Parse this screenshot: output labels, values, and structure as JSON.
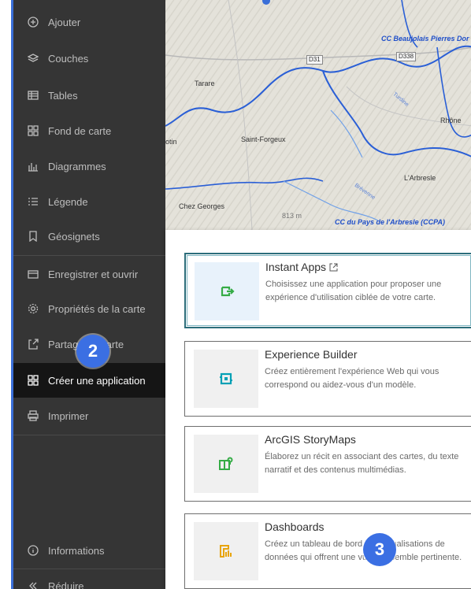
{
  "sidebar": {
    "items": [
      {
        "label": "Ajouter",
        "icon": "plus-circle-icon"
      },
      {
        "label": "Couches",
        "icon": "layers-icon"
      },
      {
        "label": "Tables",
        "icon": "table-icon"
      },
      {
        "label": "Fond de carte",
        "icon": "basemap-icon"
      },
      {
        "label": "Diagrammes",
        "icon": "chart-icon"
      },
      {
        "label": "Légende",
        "icon": "legend-icon"
      },
      {
        "label": "Géosignets",
        "icon": "bookmark-icon"
      },
      {
        "label": "Enregistrer et ouvrir",
        "icon": "folder-icon"
      },
      {
        "label": "Propriétés de la carte",
        "icon": "gear-icon"
      },
      {
        "label": "Partager la carte",
        "icon": "share-icon"
      },
      {
        "label": "Créer une application",
        "icon": "apps-grid-icon"
      },
      {
        "label": "Imprimer",
        "icon": "print-icon"
      },
      {
        "label": "Informations",
        "icon": "info-icon"
      },
      {
        "label": "Réduire",
        "icon": "collapse-icon"
      }
    ],
    "active": "Créer une application"
  },
  "map": {
    "labels": {
      "cc_beaujolais": "CC Beaujolais Pierres Dor",
      "d31": "D31",
      "d338": "D338",
      "tarare": "Tarare",
      "rhone": "Rhône",
      "saint_forgeux": "Saint-Forgeux",
      "otin": "otin",
      "arbresle": "L'Arbresle",
      "chez_georges": "Chez Georges",
      "alt": "813 m",
      "cc_arbresle": "CC du Pays de l'Arbresle (CCPA)",
      "turdine": "Turdine",
      "brevenne": "Brévenne"
    }
  },
  "panel": {
    "cards": [
      {
        "title": "Instant Apps",
        "desc": "Choisissez une application pour proposer une expérience d'utilisation ciblée de votre carte.",
        "icon": "instant-apps-icon",
        "icon_color": "#35ac46",
        "external": true
      },
      {
        "title": "Experience Builder",
        "desc": "Créez entièrement l'expérience Web qui vous correspond ou aidez-vous d'un modèle.",
        "icon": "experience-builder-icon",
        "icon_color": "#00a0b5",
        "external": false
      },
      {
        "title": "ArcGIS StoryMaps",
        "desc": "Élaborez un récit en associant des cartes, du texte narratif et des contenus multimédias.",
        "icon": "storymaps-icon",
        "icon_color": "#35ac46",
        "external": false
      },
      {
        "title": "Dashboards",
        "desc": "Créez un tableau de bord des visualisations de données qui offrent une vue d'ensemble pertinente.",
        "icon": "dashboards-icon",
        "icon_color": "#e8a40c",
        "external": false
      }
    ]
  },
  "callouts": {
    "two": "2",
    "three": "3"
  },
  "colors": {
    "accent": "#3b6fe3",
    "sidebar_bg": "#353535",
    "selected_border": "#2c6d7a"
  }
}
